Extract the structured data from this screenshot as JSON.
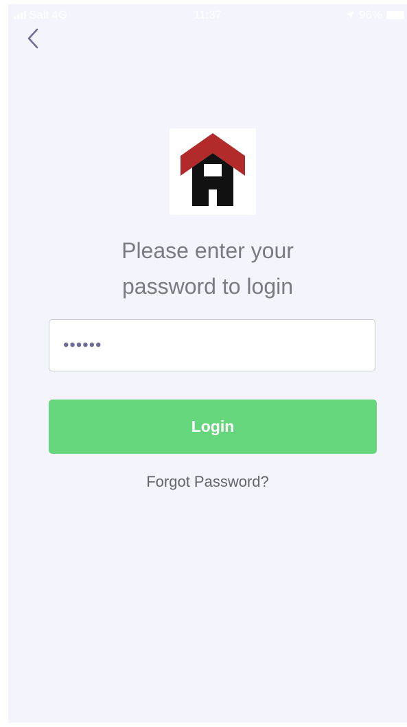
{
  "status_bar": {
    "carrier": "Salt",
    "network": "4G",
    "time": "11:37",
    "battery": "96%"
  },
  "icons": {
    "back": "chevron-left-icon",
    "logo": "house-h-logo"
  },
  "login": {
    "prompt_line1": "Please enter your",
    "prompt_line2": "password to login",
    "password_masked": "••••••",
    "login_label": "Login",
    "forgot_label": "Forgot Password?"
  },
  "colors": {
    "background": "#f3f4fc",
    "login_button": "#66d67d",
    "back_chevron": "#6f6d96",
    "logo_roof": "#b22a2a",
    "logo_letter": "#111111"
  }
}
